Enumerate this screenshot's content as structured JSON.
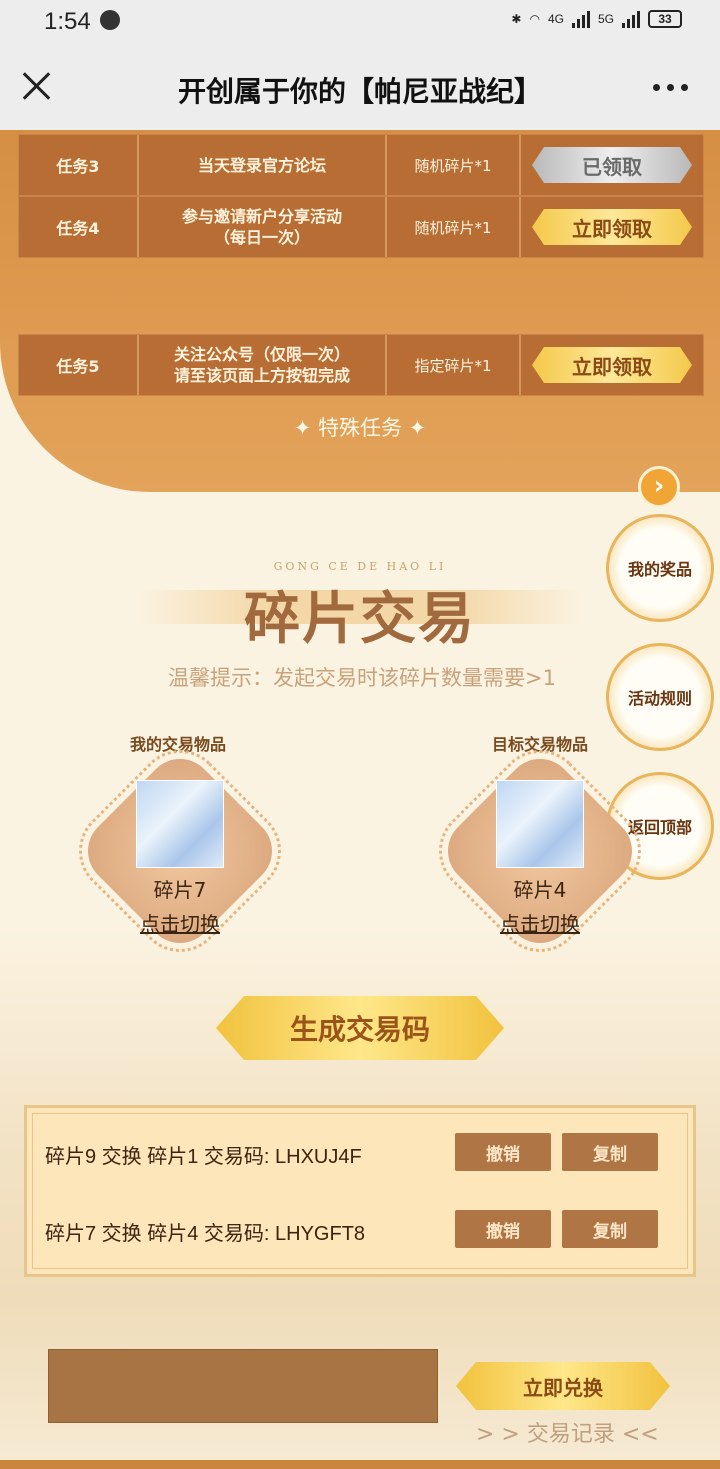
{
  "status_bar": {
    "time": "1:54",
    "network1": "4G",
    "network2": "5G",
    "battery": "33"
  },
  "titlebar": {
    "title": "开创属于你的【帕尼亚战纪】"
  },
  "tasks": [
    {
      "id": "任务3",
      "desc": "当天登录官方论坛",
      "reward": "随机碎片*1",
      "action": "已领取",
      "state": "claimed"
    },
    {
      "id": "任务4",
      "desc": "参与邀请新户分享活动\n（每日一次）",
      "reward": "随机碎片*1",
      "action": "立即领取",
      "state": "available"
    }
  ],
  "special_section": {
    "title": "✦ 特殊任务 ✦"
  },
  "special_tasks": [
    {
      "id": "任务5",
      "desc": "关注公众号（仅限一次）\n请至该页面上方按钮完成",
      "reward": "指定碎片*1",
      "action": "立即领取",
      "state": "available"
    }
  ],
  "side_nav": {
    "arrow": "›",
    "my_prizes": "我的奖品",
    "rules": "活动规则",
    "back_top": "返回顶部"
  },
  "trade": {
    "pinyin": "GONG CE DE HAO LI",
    "title": "碎片交易",
    "hint": "温馨提示：发起交易时该碎片数量需要>1",
    "my_label": "我的交易物品",
    "target_label": "目标交易物品",
    "my_item": "碎片7",
    "target_item": "碎片4",
    "switch": "点击切换",
    "generate": "生成交易码"
  },
  "records": [
    {
      "text": "碎片9 交换 碎片1 交易码:  LHXUJ4F",
      "cancel": "撤销",
      "copy": "复制"
    },
    {
      "text": "碎片7 交换 碎片4 交易码:  LHYGFT8",
      "cancel": "撤销",
      "copy": "复制"
    }
  ],
  "redeem": {
    "button": "立即兑换",
    "log": "> > 交易记录 <<"
  },
  "colors": {
    "panel": "#d99549",
    "row": "#b76d33",
    "gold": "#f4c94a",
    "accent_text": "#a0693e"
  }
}
